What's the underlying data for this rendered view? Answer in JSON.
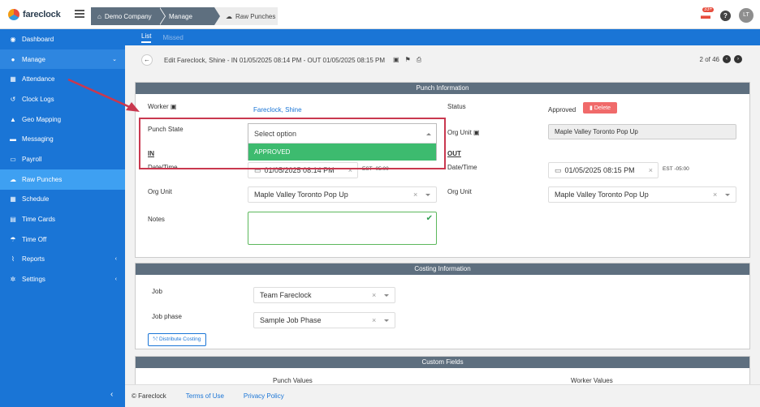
{
  "app": {
    "name": "fareclock"
  },
  "breadcrumb": [
    {
      "label": "Demo Company",
      "icon": "home-icon"
    },
    {
      "label": "Manage"
    },
    {
      "label": "Raw Punches",
      "icon": "cloud-icon"
    }
  ],
  "topbar": {
    "notification_count": "33+",
    "help_label": "?",
    "user_initials": "LT"
  },
  "sidebar": {
    "items": [
      {
        "label": "Dashboard",
        "icon": "dashboard-icon"
      },
      {
        "label": "Manage",
        "icon": "user-icon"
      },
      {
        "label": "Attendance",
        "icon": "attendance-icon"
      },
      {
        "label": "Clock Logs",
        "icon": "history-icon"
      },
      {
        "label": "Geo Mapping",
        "icon": "map-icon"
      },
      {
        "label": "Messaging",
        "icon": "message-icon"
      },
      {
        "label": "Payroll",
        "icon": "payroll-icon"
      },
      {
        "label": "Raw Punches",
        "icon": "cloud-icon"
      },
      {
        "label": "Schedule",
        "icon": "calendar-icon"
      },
      {
        "label": "Time Cards",
        "icon": "timecard-icon"
      },
      {
        "label": "Time Off",
        "icon": "umbrella-icon"
      },
      {
        "label": "Reports",
        "icon": "chart-icon"
      },
      {
        "label": "Settings",
        "icon": "gear-icon"
      }
    ]
  },
  "subnav": {
    "tabs": [
      {
        "label": "List"
      },
      {
        "label": "Missed"
      }
    ]
  },
  "edit": {
    "title": "Edit Fareclock, Shine - IN 01/05/2025 08:14 PM - OUT 01/05/2025 08:15 PM",
    "pager": "2 of 46"
  },
  "punch_info": {
    "header": "Punch Information",
    "worker_label": "Worker",
    "worker_value": "Fareclock, Shine",
    "status_label": "Status",
    "status_value": "Approved",
    "delete_label": "Delete",
    "punch_state_label": "Punch State",
    "punch_state_placeholder": "Select option",
    "punch_state_option": "APPROVED",
    "org_unit_label": "Org Unit",
    "org_unit_value": "Maple Valley Toronto Pop Up",
    "in_label": "IN",
    "out_label": "OUT",
    "datetime_label": "Date/Time",
    "in_datetime": "01/05/2025 08:14 PM",
    "out_datetime": "01/05/2025 08:15 PM",
    "timezone": "EST -05:00",
    "in_org_unit": "Maple Valley Toronto Pop Up",
    "out_org_unit": "Maple Valley Toronto Pop Up",
    "notes_label": "Notes"
  },
  "costing": {
    "header": "Costing Information",
    "job_label": "Job",
    "job_value": "Team Fareclock",
    "phase_label": "Job phase",
    "phase_value": "Sample Job Phase",
    "distribute_label": "Distribute Costing"
  },
  "custom_fields": {
    "header": "Custom Fields",
    "punch_values_label": "Punch Values",
    "worker_values_label": "Worker Values"
  },
  "footer": {
    "copyright": "© Fareclock",
    "terms": "Terms of Use",
    "privacy": "Privacy Policy"
  },
  "colors": {
    "brand_blue": "#1a75d6",
    "active_blue": "#3ea0f2",
    "header_grey": "#5e6f7f",
    "approve_green": "#3dbb6f",
    "delete_red": "#f06a6a",
    "annotation_red": "#c9384f"
  }
}
